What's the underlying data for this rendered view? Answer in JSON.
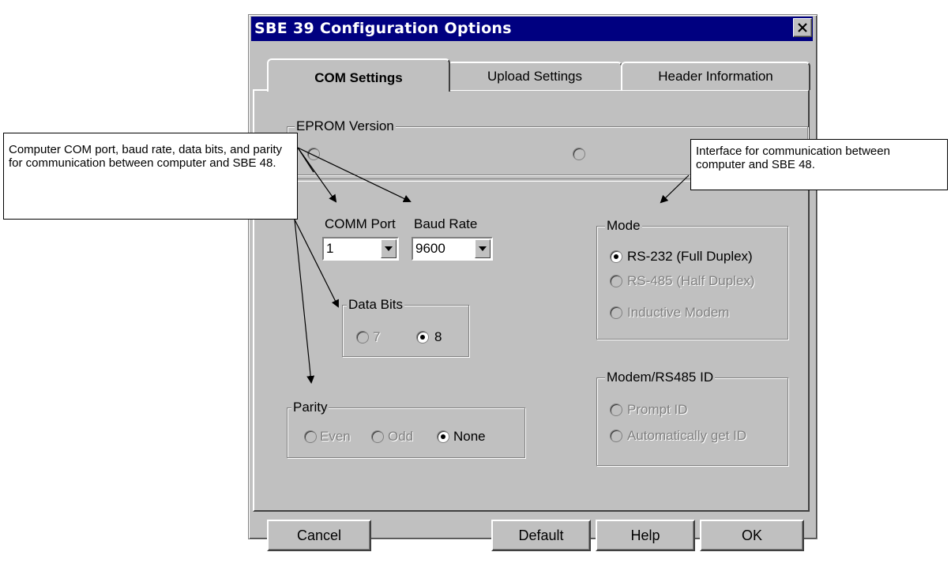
{
  "window": {
    "title": "SBE 39 Configuration Options",
    "close_icon": "close-x-icon"
  },
  "tabs": [
    {
      "label": "COM Settings",
      "active": true
    },
    {
      "label": "Upload Settings",
      "active": false
    },
    {
      "label": "Header Information",
      "active": false
    }
  ],
  "eprom": {
    "label": "EPROM Version"
  },
  "comm_port": {
    "label": "COMM Port",
    "value": "1"
  },
  "baud_rate": {
    "label": "Baud Rate",
    "value": "9600"
  },
  "data_bits": {
    "label": "Data Bits",
    "options": [
      {
        "label": "7",
        "selected": false,
        "enabled": false
      },
      {
        "label": "8",
        "selected": true,
        "enabled": true
      }
    ]
  },
  "parity": {
    "label": "Parity",
    "options": [
      {
        "label": "Even",
        "selected": false,
        "enabled": false
      },
      {
        "label": "Odd",
        "selected": false,
        "enabled": false
      },
      {
        "label": "None",
        "selected": true,
        "enabled": true
      }
    ]
  },
  "mode": {
    "label": "Mode",
    "options": [
      {
        "label": "RS-232 (Full Duplex)",
        "selected": true,
        "enabled": true
      },
      {
        "label": "RS-485 (Half Duplex)",
        "selected": false,
        "enabled": false
      },
      {
        "label": "Inductive Modem",
        "selected": false,
        "enabled": false
      }
    ]
  },
  "modem_id": {
    "label": "Modem/RS485 ID",
    "options": [
      {
        "label": "Prompt ID",
        "selected": false,
        "enabled": false
      },
      {
        "label": "Automatically get ID",
        "selected": false,
        "enabled": false
      }
    ]
  },
  "buttons": {
    "cancel": "Cancel",
    "default": "Default",
    "help": "Help",
    "ok": "OK"
  },
  "annotations": {
    "left": "Computer COM port, baud rate, data bits, and parity for communication between computer and SBE 48.",
    "right": "Interface for communication between computer and SBE 48."
  },
  "colors": {
    "titlebar": "#000080",
    "face": "#c0c0c0"
  }
}
